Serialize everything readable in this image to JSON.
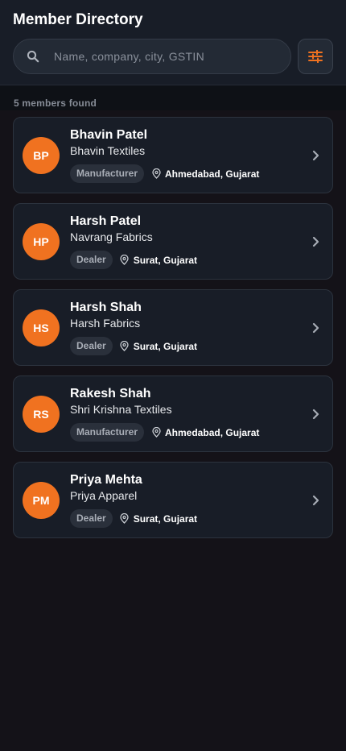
{
  "header": {
    "title": "Member Directory"
  },
  "search": {
    "placeholder": "Name, company, city, GSTIN",
    "value": ""
  },
  "results": {
    "count_label": "5 members found"
  },
  "colors": {
    "accent": "#f07220",
    "background": "#141218",
    "card": "#181d27"
  },
  "icons": {
    "search": "search-icon",
    "filter": "sliders-icon",
    "location": "map-pin-icon",
    "chevron": "chevron-right-icon"
  },
  "members": [
    {
      "initials": "BP",
      "name": "Bhavin Patel",
      "company": "Bhavin Textiles",
      "type": "Manufacturer",
      "location": "Ahmedabad, Gujarat"
    },
    {
      "initials": "HP",
      "name": "Harsh Patel",
      "company": "Navrang Fabrics",
      "type": "Dealer",
      "location": "Surat, Gujarat"
    },
    {
      "initials": "HS",
      "name": "Harsh Shah",
      "company": "Harsh Fabrics",
      "type": "Dealer",
      "location": "Surat, Gujarat"
    },
    {
      "initials": "RS",
      "name": "Rakesh Shah",
      "company": "Shri Krishna Textiles",
      "type": "Manufacturer",
      "location": "Ahmedabad, Gujarat"
    },
    {
      "initials": "PM",
      "name": "Priya Mehta",
      "company": "Priya Apparel",
      "type": "Dealer",
      "location": "Surat, Gujarat"
    }
  ]
}
